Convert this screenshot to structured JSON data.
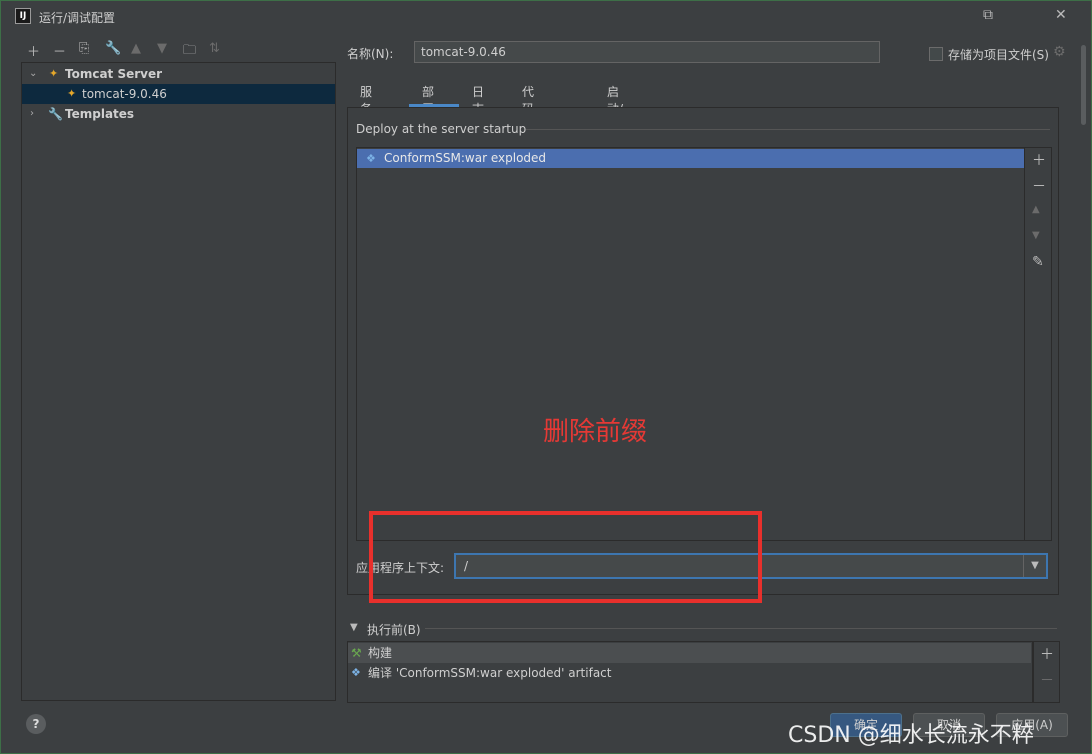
{
  "window": {
    "title": "运行/调试配置",
    "app_icon": "IJ"
  },
  "toolbar": {
    "icons": [
      "plus-icon",
      "minus-icon",
      "copy-icon",
      "wrench-icon",
      "arrow-up-icon",
      "arrow-down-icon",
      "folder-add-icon",
      "sort-icon"
    ]
  },
  "tree": {
    "tomcat_group": "Tomcat Server",
    "tomcat_item": "tomcat-9.0.46",
    "templates": "Templates"
  },
  "config": {
    "name_label": "名称(N):",
    "name_value": "tomcat-9.0.46",
    "store_label": "存储为项目文件(S)"
  },
  "tabs": [
    {
      "label": "服务器"
    },
    {
      "label": "部署"
    },
    {
      "label": "日志"
    },
    {
      "label": "代码覆盖率"
    },
    {
      "label": "启动/连接"
    }
  ],
  "deploy": {
    "section_label": "Deploy at the server startup",
    "items": [
      "ConformSSM:war exploded"
    ]
  },
  "annotation": "删除前缀",
  "context": {
    "label": "应用程序上下文:",
    "value": "/"
  },
  "before_launch": {
    "label": "执行前(B)",
    "items": [
      "构建",
      "编译 'ConformSSM:war exploded' artifact"
    ]
  },
  "buttons": {
    "ok": "确定",
    "cancel": "取消",
    "apply": "应用(A)"
  },
  "watermark": "CSDN @细水长流永不粹"
}
